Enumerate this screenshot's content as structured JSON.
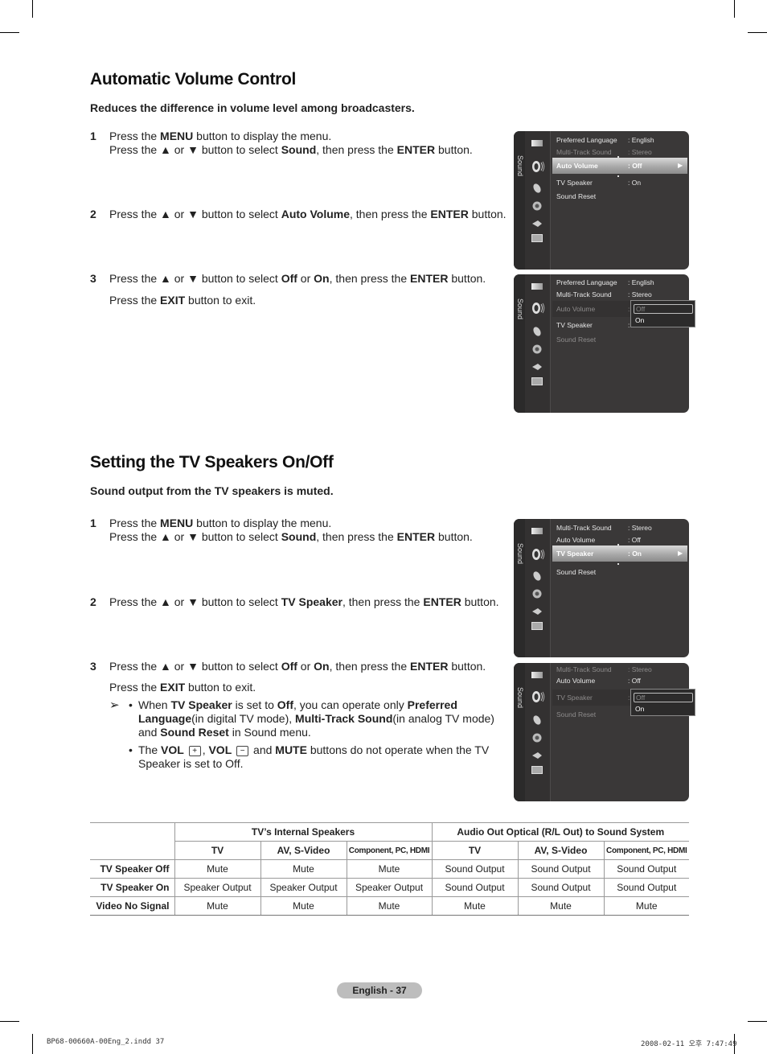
{
  "sections": {
    "auto_volume": {
      "title": "Automatic Volume Control",
      "subtitle": "Reduces the difference in volume level among broadcasters.",
      "steps": [
        {
          "num": "1",
          "line1_a": "Press the ",
          "line1_b": "MENU",
          "line1_c": " button to display the menu.",
          "line2_a": "Press the ▲ or ▼ button to select ",
          "line2_b": "Sound",
          "line2_c": ", then press the ",
          "line2_d": "ENTER",
          "line2_e": " button."
        },
        {
          "num": "2",
          "a": "Press the ▲ or ▼ button to select ",
          "b": "Auto Volume",
          "c": ", then press the ",
          "d": "ENTER",
          "e": " button."
        },
        {
          "num": "3",
          "a": "Press the ▲ or ▼ button to select ",
          "b": "Off",
          "c": " or ",
          "d": "On",
          "e": ", then press the ",
          "f": "ENTER",
          "g": " button.",
          "exit_a": "Press the ",
          "exit_b": "EXIT",
          "exit_c": " button to exit."
        }
      ]
    },
    "tv_speakers": {
      "title": "Setting the TV Speakers On/Off",
      "subtitle": "Sound output from the TV speakers is muted.",
      "steps": [
        {
          "num": "1",
          "line1_a": "Press the ",
          "line1_b": "MENU",
          "line1_c": " button to display the menu.",
          "line2_a": "Press the ▲ or ▼ button to select ",
          "line2_b": "Sound",
          "line2_c": ", then press the ",
          "line2_d": "ENTER",
          "line2_e": " button."
        },
        {
          "num": "2",
          "a": "Press the ▲ or ▼ button to select ",
          "b": "TV Speaker",
          "c": ", then press the ",
          "d": "ENTER",
          "e": " button."
        },
        {
          "num": "3",
          "a": "Press the ▲ or ▼ button to select ",
          "b": "Off",
          "c": " or ",
          "d": "On",
          "e": ", then press the ",
          "f": "ENTER",
          "g": " button.",
          "exit_a": "Press the ",
          "exit_b": "EXIT",
          "exit_c": " button to exit."
        }
      ],
      "note": {
        "arrow": "➢",
        "bullet": "•",
        "b1_a": "When ",
        "b1_b": "TV Speaker",
        "b1_c": " is set to ",
        "b1_d": "Off",
        "b1_e": ", you can operate only ",
        "b1_f": "Preferred Language",
        "b1_g": "(in digital TV mode), ",
        "b1_h": "Multi-Track Sound",
        "b1_i": "(in analog TV mode) and ",
        "b1_j": "Sound Reset",
        "b1_k": " in Sound menu.",
        "b2_a": "The ",
        "b2_b": "VOL",
        "b2_plus": "+",
        "b2_c": ", ",
        "b2_d": "VOL",
        "b2_minus": "−",
        "b2_e": " and ",
        "b2_f": "MUTE",
        "b2_g": " buttons do not operate when the TV Speaker is set to Off."
      }
    }
  },
  "osd": {
    "rail_label": "Sound",
    "screen1": {
      "items": [
        {
          "label": "Preferred Language",
          "value": ": English"
        },
        {
          "label": "Multi-Track Sound",
          "value": ": Stereo"
        },
        {
          "label": "Auto Volume",
          "value": ": Off"
        },
        {
          "label": "TV Speaker",
          "value": ": On"
        },
        {
          "label": "Sound Reset",
          "value": ""
        }
      ],
      "arrow": "▶"
    },
    "screen2": {
      "items": [
        {
          "label": "Preferred Language",
          "value": ": English"
        },
        {
          "label": "Multi-Track Sound",
          "value": ": Stereo"
        },
        {
          "label": "Auto Volume",
          "value": ":"
        },
        {
          "label": "TV  Speaker",
          "value": ":"
        },
        {
          "label": "Sound Reset",
          "value": ""
        }
      ],
      "options": [
        "Off",
        "On"
      ]
    },
    "screen3": {
      "items": [
        {
          "label": "Multi-Track Sound",
          "value": ": Stereo"
        },
        {
          "label": "Auto Volume",
          "value": ": Off"
        },
        {
          "label": "TV Speaker",
          "value": ": On"
        },
        {
          "label": "Sound Reset",
          "value": ""
        }
      ],
      "arrow": "▶"
    },
    "screen4": {
      "items": [
        {
          "label": "Multi-Track Sound",
          "value": ": Stereo"
        },
        {
          "label": "Auto Volume",
          "value": ": Off"
        },
        {
          "label": "TV Speaker",
          "value": ":"
        },
        {
          "label": "Sound Reset",
          "value": ""
        }
      ],
      "options": [
        "Off",
        "On"
      ]
    }
  },
  "table": {
    "group_headers": [
      "TV’s Internal Speakers",
      "Audio Out Optical (R/L Out) to Sound System"
    ],
    "sub_headers": [
      "TV",
      "AV, S-Video",
      "Component, PC, HDMI",
      "TV",
      "AV, S-Video",
      "Component, PC, HDMI"
    ],
    "rows": [
      {
        "label": "TV Speaker Off",
        "cells": [
          "Mute",
          "Mute",
          "Mute",
          "Sound Output",
          "Sound Output",
          "Sound Output"
        ]
      },
      {
        "label": "TV Speaker On",
        "cells": [
          "Speaker Output",
          "Speaker Output",
          "Speaker Output",
          "Sound Output",
          "Sound Output",
          "Sound Output"
        ]
      },
      {
        "label": "Video No Signal",
        "cells": [
          "Mute",
          "Mute",
          "Mute",
          "Mute",
          "Mute",
          "Mute"
        ]
      }
    ]
  },
  "page_label": "English - 37",
  "footer": {
    "file": "BP68-00660A-00Eng_2.indd   37",
    "timestamp": "2008-02-11   오후 7:47:49"
  }
}
